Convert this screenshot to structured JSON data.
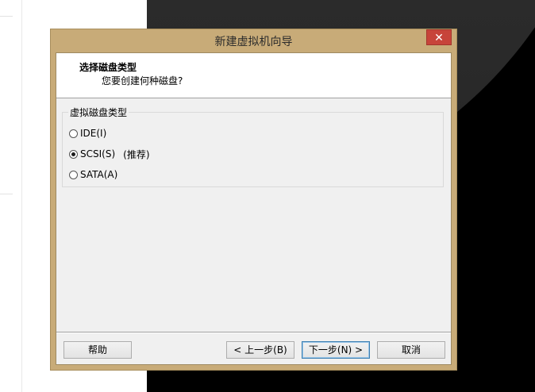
{
  "window": {
    "title": "新建虚拟机向导",
    "close_glyph": "✕"
  },
  "header": {
    "title": "选择磁盘类型",
    "subtitle": "您要创建何种磁盘?"
  },
  "disk_type_group": {
    "legend": "虚拟磁盘类型",
    "options": [
      {
        "label": "IDE(I)",
        "checked": false,
        "note": ""
      },
      {
        "label": "SCSI(S)",
        "checked": true,
        "note": "(推荐)"
      },
      {
        "label": "SATA(A)",
        "checked": false,
        "note": ""
      }
    ]
  },
  "buttons": {
    "help": "帮助",
    "back": "< 上一步(B)",
    "next": "下一步(N) >",
    "cancel": "取消"
  }
}
